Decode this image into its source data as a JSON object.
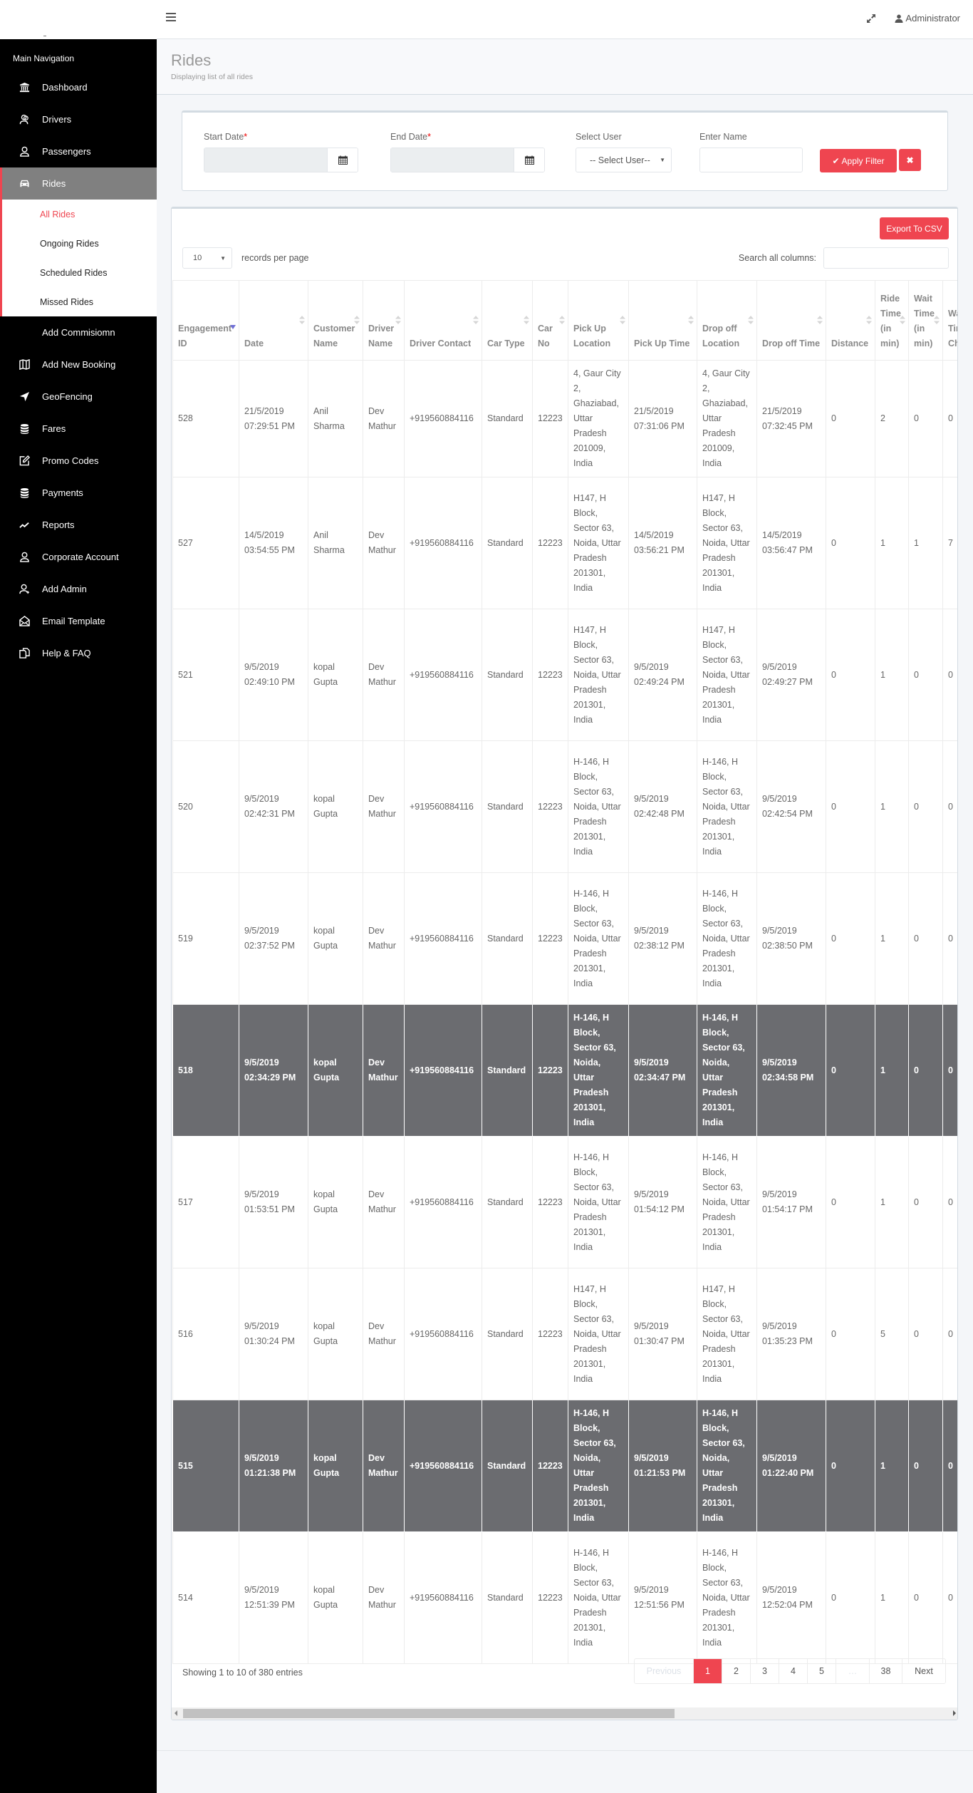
{
  "header": {
    "user_label": "Administrator",
    "icons": {
      "menu": "hamburger-icon",
      "fullscreen": "expand-icon",
      "user": "user-icon"
    }
  },
  "sidebar": {
    "section_title": "Main Navigation",
    "items": [
      {
        "label": "Dashboard",
        "icon": "bank-icon"
      },
      {
        "label": "Drivers",
        "icon": "users-icon"
      },
      {
        "label": "Passengers",
        "icon": "user-icon"
      },
      {
        "label": "Rides",
        "icon": "car-icon",
        "active": true
      },
      {
        "label": "Add Commisiomn",
        "icon": ""
      },
      {
        "label": "Add New Booking",
        "icon": "map-icon"
      },
      {
        "label": "GeoFencing",
        "icon": "location-arrow-icon"
      },
      {
        "label": "Fares",
        "icon": "database-icon"
      },
      {
        "label": "Promo Codes",
        "icon": "edit-icon"
      },
      {
        "label": "Payments",
        "icon": "database-icon"
      },
      {
        "label": "Reports",
        "icon": "line-chart-icon"
      },
      {
        "label": "Corporate Account",
        "icon": "user-icon"
      },
      {
        "label": "Add Admin",
        "icon": "user-add-icon"
      },
      {
        "label": "Email Template",
        "icon": "envelope-open-icon"
      },
      {
        "label": "Help & FAQ",
        "icon": "copy-icon"
      }
    ],
    "rides_submenu": [
      {
        "label": "All Rides",
        "active": true
      },
      {
        "label": "Ongoing Rides"
      },
      {
        "label": "Scheduled Rides"
      },
      {
        "label": "Missed Rides"
      }
    ]
  },
  "page": {
    "title": "Rides",
    "subtitle": "Displaying list of all rides"
  },
  "filters": {
    "start_date_label": "Start Date",
    "end_date_label": "End Date",
    "required_mark": "*",
    "start_date_value": "",
    "end_date_value": "",
    "select_user_label": "Select User",
    "select_user_value": "-- Select User--",
    "enter_name_label": "Enter Name",
    "enter_name_value": "",
    "apply_label": "Apply Filter",
    "clear_label": "✖"
  },
  "table": {
    "export_label": "Export To CSV",
    "page_length": "10",
    "page_length_suffix": "records per page",
    "search_label": "Search all columns:",
    "search_value": "",
    "columns": [
      "Engagement ID",
      "Date",
      "Customer Name",
      "Driver Name",
      "Driver Contact",
      "Car Type",
      "Car No",
      "Pick Up Location",
      "Pick Up Time",
      "Drop off Location",
      "Drop off Time",
      "Distance",
      "Ride Time (in min)",
      "Wait Time (in min)",
      "Wait Time Charge"
    ],
    "rows": [
      {
        "id": "528",
        "date": "21/5/2019 07:29:51 PM",
        "customer": "Anil Sharma",
        "driver": "Dev Mathur",
        "contact": "+919560884116",
        "car_type": "Standard",
        "car_no": "12223",
        "pickup_loc": "4, Gaur City 2, Ghaziabad, Uttar Pradesh 201009, India",
        "pickup_time": "21/5/2019 07:31:06 PM",
        "drop_loc": "4, Gaur City 2, Ghaziabad, Uttar Pradesh 201009, India",
        "drop_time": "21/5/2019 07:32:45 PM",
        "distance": "0",
        "ride_time": "2",
        "wait_time": "0",
        "wait_charge": "0",
        "selected": false
      },
      {
        "id": "527",
        "date": "14/5/2019 03:54:55 PM",
        "customer": "Anil Sharma",
        "driver": "Dev Mathur",
        "contact": "+919560884116",
        "car_type": "Standard",
        "car_no": "12223",
        "pickup_loc": "H147, H Block, Sector 63, Noida, Uttar Pradesh 201301, India",
        "pickup_time": "14/5/2019 03:56:21 PM",
        "drop_loc": "H147, H Block, Sector 63, Noida, Uttar Pradesh 201301, India",
        "drop_time": "14/5/2019 03:56:47 PM",
        "distance": "0",
        "ride_time": "1",
        "wait_time": "1",
        "wait_charge": "7",
        "selected": false
      },
      {
        "id": "521",
        "date": "9/5/2019 02:49:10 PM",
        "customer": "kopal Gupta",
        "driver": "Dev Mathur",
        "contact": "+919560884116",
        "car_type": "Standard",
        "car_no": "12223",
        "pickup_loc": "H147, H Block, Sector 63, Noida, Uttar Pradesh 201301, India",
        "pickup_time": "9/5/2019 02:49:24 PM",
        "drop_loc": "H147, H Block, Sector 63, Noida, Uttar Pradesh 201301, India",
        "drop_time": "9/5/2019 02:49:27 PM",
        "distance": "0",
        "ride_time": "1",
        "wait_time": "0",
        "wait_charge": "0",
        "selected": false
      },
      {
        "id": "520",
        "date": "9/5/2019 02:42:31 PM",
        "customer": "kopal Gupta",
        "driver": "Dev Mathur",
        "contact": "+919560884116",
        "car_type": "Standard",
        "car_no": "12223",
        "pickup_loc": "H-146, H Block, Sector 63, Noida, Uttar Pradesh 201301, India",
        "pickup_time": "9/5/2019 02:42:48 PM",
        "drop_loc": "H-146, H Block, Sector 63, Noida, Uttar Pradesh 201301, India",
        "drop_time": "9/5/2019 02:42:54 PM",
        "distance": "0",
        "ride_time": "1",
        "wait_time": "0",
        "wait_charge": "0",
        "selected": false
      },
      {
        "id": "519",
        "date": "9/5/2019 02:37:52 PM",
        "customer": "kopal Gupta",
        "driver": "Dev Mathur",
        "contact": "+919560884116",
        "car_type": "Standard",
        "car_no": "12223",
        "pickup_loc": "H-146, H Block, Sector 63, Noida, Uttar Pradesh 201301, India",
        "pickup_time": "9/5/2019 02:38:12 PM",
        "drop_loc": "H-146, H Block, Sector 63, Noida, Uttar Pradesh 201301, India",
        "drop_time": "9/5/2019 02:38:50 PM",
        "distance": "0",
        "ride_time": "1",
        "wait_time": "0",
        "wait_charge": "0",
        "selected": false
      },
      {
        "id": "518",
        "date": "9/5/2019 02:34:29 PM",
        "customer": "kopal Gupta",
        "driver": "Dev Mathur",
        "contact": "+919560884116",
        "car_type": "Standard",
        "car_no": "12223",
        "pickup_loc": "H-146, H Block, Sector 63, Noida, Uttar Pradesh 201301, India",
        "pickup_time": "9/5/2019 02:34:47 PM",
        "drop_loc": "H-146, H Block, Sector 63, Noida, Uttar Pradesh 201301, India",
        "drop_time": "9/5/2019 02:34:58 PM",
        "distance": "0",
        "ride_time": "1",
        "wait_time": "0",
        "wait_charge": "0",
        "selected": true
      },
      {
        "id": "517",
        "date": "9/5/2019 01:53:51 PM",
        "customer": "kopal Gupta",
        "driver": "Dev Mathur",
        "contact": "+919560884116",
        "car_type": "Standard",
        "car_no": "12223",
        "pickup_loc": "H-146, H Block, Sector 63, Noida, Uttar Pradesh 201301, India",
        "pickup_time": "9/5/2019 01:54:12 PM",
        "drop_loc": "H-146, H Block, Sector 63, Noida, Uttar Pradesh 201301, India",
        "drop_time": "9/5/2019 01:54:17 PM",
        "distance": "0",
        "ride_time": "1",
        "wait_time": "0",
        "wait_charge": "0",
        "selected": false
      },
      {
        "id": "516",
        "date": "9/5/2019 01:30:24 PM",
        "customer": "kopal Gupta",
        "driver": "Dev Mathur",
        "contact": "+919560884116",
        "car_type": "Standard",
        "car_no": "12223",
        "pickup_loc": "H147, H Block, Sector 63, Noida, Uttar Pradesh 201301, India",
        "pickup_time": "9/5/2019 01:30:47 PM",
        "drop_loc": "H147, H Block, Sector 63, Noida, Uttar Pradesh 201301, India",
        "drop_time": "9/5/2019 01:35:23 PM",
        "distance": "0",
        "ride_time": "5",
        "wait_time": "0",
        "wait_charge": "0",
        "selected": false
      },
      {
        "id": "515",
        "date": "9/5/2019 01:21:38 PM",
        "customer": "kopal Gupta",
        "driver": "Dev Mathur",
        "contact": "+919560884116",
        "car_type": "Standard",
        "car_no": "12223",
        "pickup_loc": "H-146, H Block, Sector 63, Noida, Uttar Pradesh 201301, India",
        "pickup_time": "9/5/2019 01:21:53 PM",
        "drop_loc": "H-146, H Block, Sector 63, Noida, Uttar Pradesh 201301, India",
        "drop_time": "9/5/2019 01:22:40 PM",
        "distance": "0",
        "ride_time": "1",
        "wait_time": "0",
        "wait_charge": "0",
        "selected": true
      },
      {
        "id": "514",
        "date": "9/5/2019 12:51:39 PM",
        "customer": "kopal Gupta",
        "driver": "Dev Mathur",
        "contact": "+919560884116",
        "car_type": "Standard",
        "car_no": "12223",
        "pickup_loc": "H-146, H Block, Sector 63, Noida, Uttar Pradesh 201301, India",
        "pickup_time": "9/5/2019 12:51:56 PM",
        "drop_loc": "H-146, H Block, Sector 63, Noida, Uttar Pradesh 201301, India",
        "drop_time": "9/5/2019 12:52:04 PM",
        "distance": "0",
        "ride_time": "1",
        "wait_time": "0",
        "wait_charge": "0",
        "selected": false
      }
    ],
    "info": "Showing 1 to 10 of 380 entries",
    "pagination": {
      "previous": "Previous",
      "pages": [
        "1",
        "2",
        "3",
        "4",
        "5",
        "…",
        "38"
      ],
      "current": "1",
      "next": "Next"
    }
  },
  "colors": {
    "accent": "#ef4550",
    "sidebar_bg": "#000000",
    "sidebar_active_bg": "#808080",
    "selected_row_bg": "#6b6c70"
  }
}
